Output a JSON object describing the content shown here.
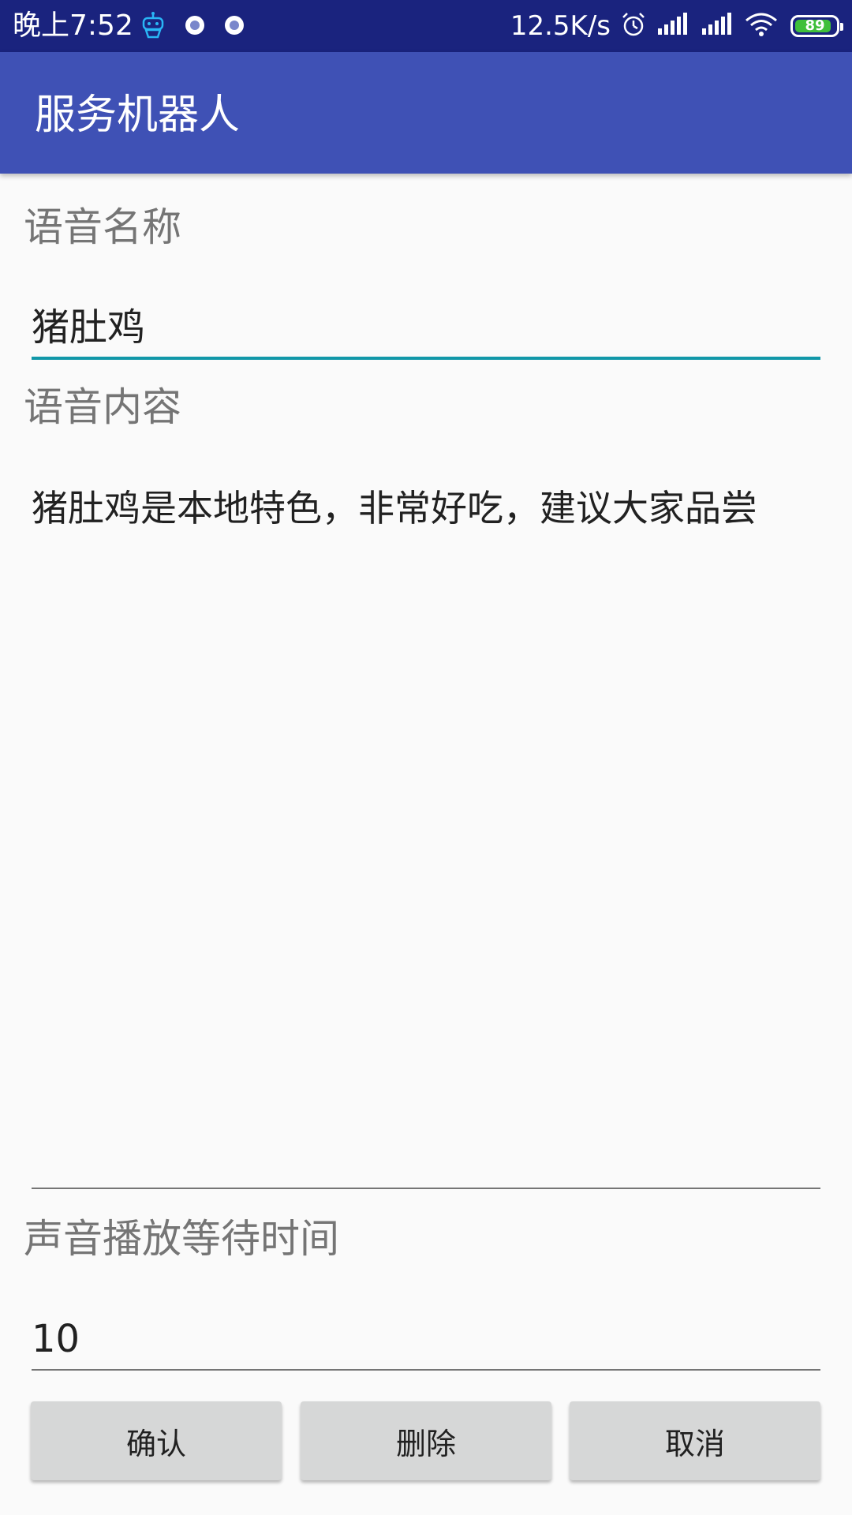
{
  "status_bar": {
    "time": "晚上7:52",
    "net_speed": "12.5K/s",
    "battery_level": "89",
    "battery_fraction": 0.89,
    "icons": [
      "robot-app-icon",
      "notification-dot-icon",
      "notification-dot-icon",
      "alarm-icon",
      "signal-icon",
      "signal-icon",
      "wifi-icon",
      "battery-icon"
    ]
  },
  "app_bar": {
    "title": "服务机器人"
  },
  "form": {
    "name_label": "语音名称",
    "name_value": "猪肚鸡",
    "content_label": "语音内容",
    "content_value": "猪肚鸡是本地特色，非常好吃，建议大家品尝",
    "wait_label": "声音播放等待时间",
    "wait_value": "10"
  },
  "buttons": {
    "confirm": "确认",
    "delete": "删除",
    "cancel": "取消"
  },
  "colors": {
    "status_bar": "#1a237e",
    "app_bar": "#3f51b5",
    "focus_accent": "#1197a8",
    "battery_green": "#3fbf3a",
    "button_bg": "#d6d7d7"
  }
}
